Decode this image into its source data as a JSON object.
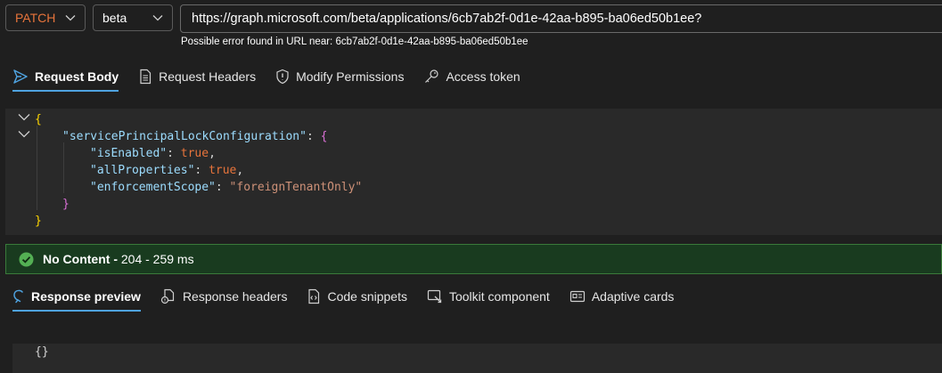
{
  "request": {
    "method": "PATCH",
    "version": "beta",
    "url": "https://graph.microsoft.com/beta/applications/6cb7ab2f-0d1e-42aa-b895-ba06ed50b1ee?",
    "url_error": "Possible error found in URL near: 6cb7ab2f-0d1e-42aa-b895-ba06ed50b1ee"
  },
  "request_tabs": [
    {
      "label": "Request Body",
      "icon": "send-icon",
      "active": true
    },
    {
      "label": "Request Headers",
      "icon": "document-icon"
    },
    {
      "label": "Modify Permissions",
      "icon": "shield-icon"
    },
    {
      "label": "Access token",
      "icon": "key-icon"
    }
  ],
  "body_lines": [
    {
      "indent": 0,
      "tokens": [
        {
          "t": "{",
          "c": "brace1"
        }
      ]
    },
    {
      "indent": 1,
      "tokens": [
        {
          "t": "\"servicePrincipalLockConfiguration\"",
          "c": "key"
        },
        {
          "t": ": ",
          "c": "punct"
        },
        {
          "t": "{",
          "c": "brace2"
        }
      ]
    },
    {
      "indent": 2,
      "tokens": [
        {
          "t": "\"isEnabled\"",
          "c": "key"
        },
        {
          "t": ": ",
          "c": "punct"
        },
        {
          "t": "true",
          "c": "bool"
        },
        {
          "t": ",",
          "c": "punct"
        }
      ]
    },
    {
      "indent": 2,
      "tokens": [
        {
          "t": "\"allProperties\"",
          "c": "key"
        },
        {
          "t": ": ",
          "c": "punct"
        },
        {
          "t": "true",
          "c": "bool"
        },
        {
          "t": ",",
          "c": "punct"
        }
      ]
    },
    {
      "indent": 2,
      "tokens": [
        {
          "t": "\"enforcementScope\"",
          "c": "key"
        },
        {
          "t": ": ",
          "c": "punct"
        },
        {
          "t": "\"foreignTenantOnly\"",
          "c": "str"
        }
      ]
    },
    {
      "indent": 1,
      "tokens": [
        {
          "t": "}",
          "c": "brace2"
        }
      ]
    },
    {
      "indent": 0,
      "tokens": [
        {
          "t": "}",
          "c": "brace1"
        }
      ]
    }
  ],
  "status": {
    "title": "No Content - ",
    "detail": "204 - 259 ms",
    "color": "#193b1f"
  },
  "response_tabs": [
    {
      "label": "Response preview",
      "icon": "preview-icon",
      "active": true
    },
    {
      "label": "Response headers",
      "icon": "headers-icon"
    },
    {
      "label": "Code snippets",
      "icon": "code-icon"
    },
    {
      "label": "Toolkit component",
      "icon": "toolkit-icon"
    },
    {
      "label": "Adaptive cards",
      "icon": "card-icon"
    }
  ],
  "response_body": "{}"
}
